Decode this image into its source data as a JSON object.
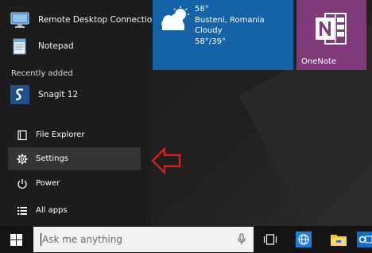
{
  "pinned_apps": [
    {
      "label": "Remote Desktop Connection",
      "icon": "remote-desktop-icon"
    },
    {
      "label": "Notepad",
      "icon": "notepad-icon"
    }
  ],
  "recently_added": {
    "header": "Recently added",
    "items": [
      {
        "label": "Snagit 12",
        "icon": "snagit-icon"
      }
    ]
  },
  "nav": {
    "file_explorer": "File Explorer",
    "settings": "Settings",
    "power": "Power",
    "all_apps": "All apps"
  },
  "tiles": {
    "weather": {
      "temp": "58°",
      "location": "Busteni, Romania",
      "condition": "Cloudy",
      "hi_lo": "58°/39°",
      "icon": "partly-cloudy-icon",
      "color": "#1463a9"
    },
    "onenote": {
      "label": "OneNote",
      "icon": "onenote-icon",
      "color": "#80397b"
    }
  },
  "taskbar": {
    "search_placeholder": "Ask me anything",
    "icons": [
      "windows-logo-icon",
      "microphone-icon",
      "task-view-icon",
      "edge-globe-icon",
      "folder-icon",
      "outlook-icon"
    ]
  },
  "annotation": {
    "arrow_color": "#e0201b"
  },
  "colors": {
    "start_bg": "#1c1c1c",
    "selected_row": "#343434",
    "taskbar_bg": "#131313",
    "search_bg": "#f2f2f2",
    "accent_blue": "#1463a9",
    "onenote_purple": "#80397b"
  }
}
